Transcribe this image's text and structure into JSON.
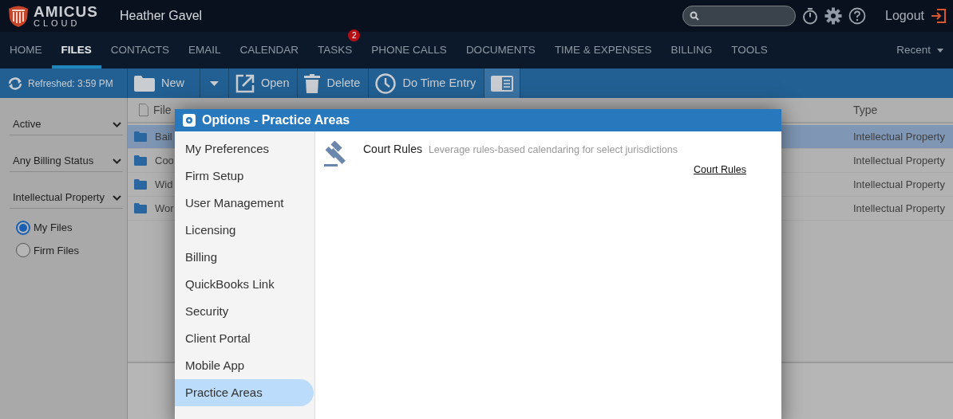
{
  "header": {
    "logo_word": "AMICUS",
    "logo_sub": "CLOUD",
    "user": "Heather Gavel",
    "logout": "Logout"
  },
  "nav": {
    "tabs": [
      {
        "label": "HOME",
        "selected": false
      },
      {
        "label": "FILES",
        "selected": true
      },
      {
        "label": "CONTACTS",
        "selected": false
      },
      {
        "label": "EMAIL",
        "selected": false
      },
      {
        "label": "CALENDAR",
        "selected": false
      },
      {
        "label": "TASKS",
        "selected": false,
        "badge": "2"
      },
      {
        "label": "PHONE CALLS",
        "selected": false
      },
      {
        "label": "DOCUMENTS",
        "selected": false
      },
      {
        "label": "TIME & EXPENSES",
        "selected": false
      },
      {
        "label": "BILLING",
        "selected": false
      },
      {
        "label": "TOOLS",
        "selected": false
      }
    ],
    "recent": "Recent"
  },
  "toolbar": {
    "refreshed": "Refreshed: 3:59 PM",
    "buttons": [
      {
        "label": "New",
        "kind": "new"
      },
      {
        "label": "Open",
        "kind": "open"
      },
      {
        "label": "Delete",
        "kind": "delete"
      },
      {
        "label": "Do Time Entry",
        "kind": "time"
      }
    ]
  },
  "filters": {
    "selects": [
      "Active",
      "Any Billing Status",
      "Intellectual Property"
    ],
    "radios": [
      {
        "label": "My Files",
        "selected": true
      },
      {
        "label": "Firm Files",
        "selected": false
      }
    ]
  },
  "table": {
    "columns": [
      "File",
      "Type"
    ],
    "rows": [
      {
        "cells": [
          "Bail",
          "Intellectual Property"
        ],
        "selected": true
      },
      {
        "cells": [
          "Coo",
          "Intellectual Property"
        ],
        "selected": false
      },
      {
        "cells": [
          "Wid",
          "Intellectual Property"
        ],
        "selected": false
      },
      {
        "cells": [
          "Wor",
          "Intellectual Property"
        ],
        "selected": false
      }
    ]
  },
  "dialog": {
    "title": "Options - Practice Areas",
    "menu": [
      {
        "label": "My Preferences",
        "selected": false
      },
      {
        "label": "Firm Setup",
        "selected": false
      },
      {
        "label": "User Management",
        "selected": false
      },
      {
        "label": "Licensing",
        "selected": false
      },
      {
        "label": "Billing",
        "selected": false
      },
      {
        "label": "QuickBooks Link",
        "selected": false
      },
      {
        "label": "Security",
        "selected": false
      },
      {
        "label": "Client Portal",
        "selected": false
      },
      {
        "label": "Mobile App",
        "selected": false
      },
      {
        "label": "Practice Areas",
        "selected": true
      }
    ],
    "areas": [
      {
        "title": "Court Rules",
        "description": "Leverage rules-based calendaring for select jurisdictions",
        "link": "Court Rules"
      }
    ]
  }
}
